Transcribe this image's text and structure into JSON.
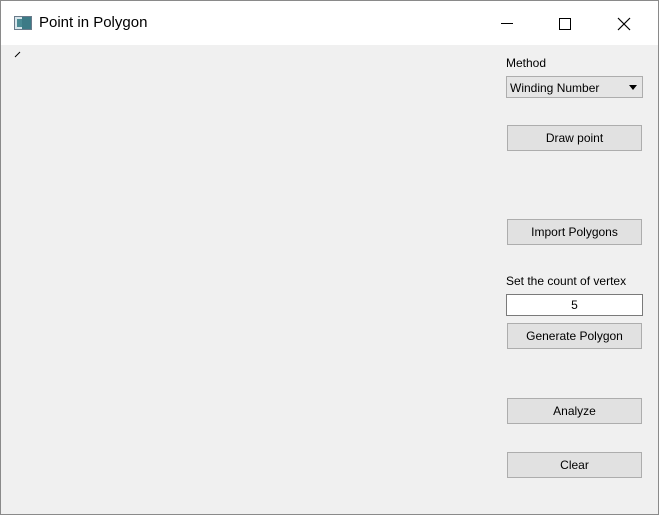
{
  "window": {
    "title": "Point in Polygon"
  },
  "panel": {
    "method_label": "Method",
    "method_value": "Winding Number",
    "draw_point_label": "Draw point",
    "import_label": "Import Polygons",
    "vertex_count_label": "Set the count of vertex",
    "vertex_count_value": "5",
    "generate_label": "Generate Polygon",
    "analyze_label": "Analyze",
    "clear_label": "Clear"
  },
  "icons": {
    "app": "app-icon",
    "minimize": "minimize-icon",
    "maximize": "maximize-icon",
    "close": "close-icon",
    "dropdown": "chevron-down-icon"
  },
  "colors": {
    "window_bg": "#f0f0f0",
    "titlebar_bg": "#ffffff",
    "button_bg": "#e1e1e1",
    "button_border": "#adadad"
  }
}
